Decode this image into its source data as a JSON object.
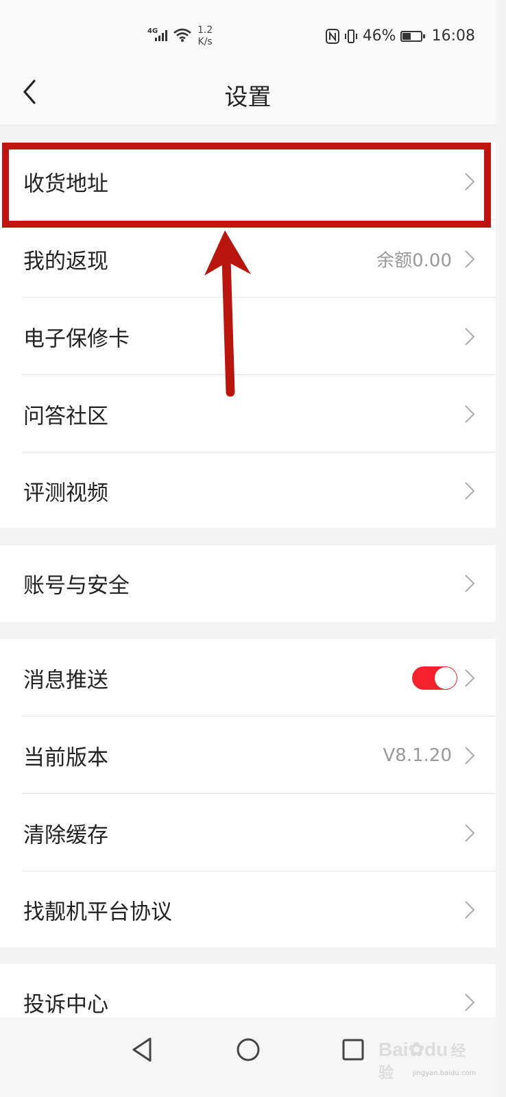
{
  "status_bar": {
    "network_label": "4G",
    "speed_value": "1.2",
    "speed_unit": "K/s",
    "battery_percent": "46%",
    "battery_level": 0.46,
    "time": "16:08"
  },
  "header": {
    "title": "设置"
  },
  "groups": [
    {
      "rows": [
        {
          "label": "收货地址"
        },
        {
          "label": "我的返现",
          "value": "余额0.00"
        },
        {
          "label": "电子保修卡"
        },
        {
          "label": "问答社区"
        },
        {
          "label": "评测视频"
        }
      ]
    },
    {
      "rows": [
        {
          "label": "账号与安全"
        }
      ]
    },
    {
      "rows": [
        {
          "label": "消息推送",
          "toggle_on": true
        },
        {
          "label": "当前版本",
          "value": "V8.1.20"
        },
        {
          "label": "清除缓存"
        },
        {
          "label": "找靓机平台协议"
        }
      ]
    },
    {
      "rows": [
        {
          "label": "投诉中心"
        }
      ]
    }
  ],
  "watermark": {
    "brand": "Bai",
    "brand2": "du",
    "cn": "经验",
    "url": "jingyan.baidu.com"
  },
  "colors": {
    "accent": "#f5222d",
    "highlight": "#c0140e"
  }
}
